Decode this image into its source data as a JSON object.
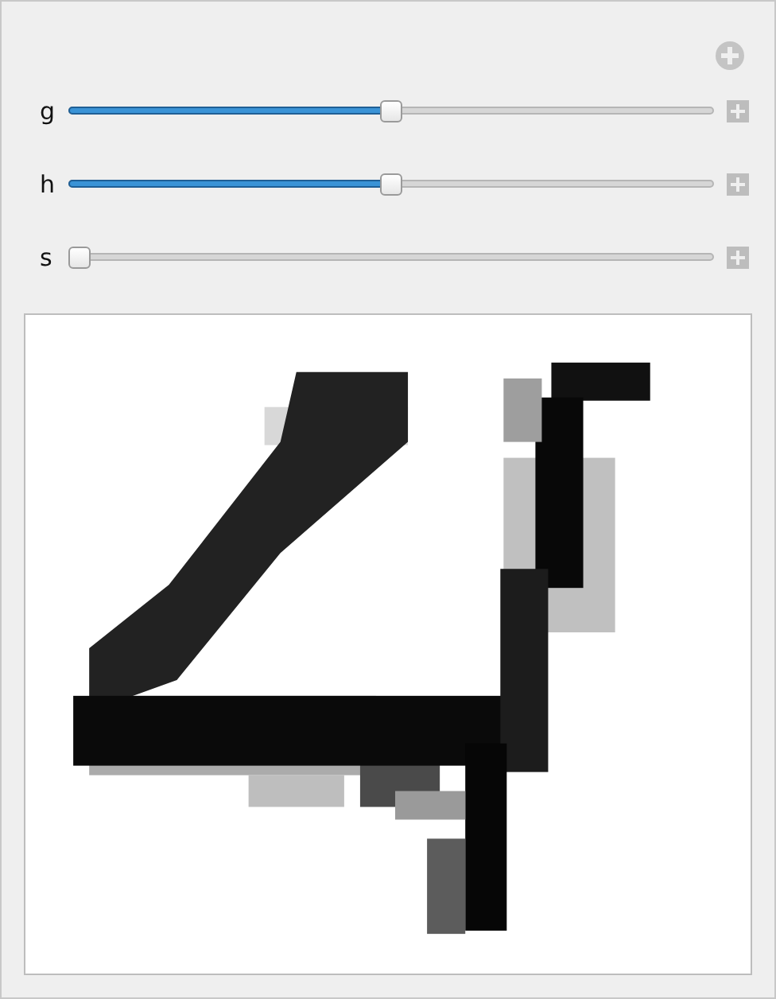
{
  "sliders": [
    {
      "label": "g",
      "level": 0.5
    },
    {
      "label": "h",
      "level": 0.5
    },
    {
      "label": "s",
      "level": 0
    }
  ]
}
